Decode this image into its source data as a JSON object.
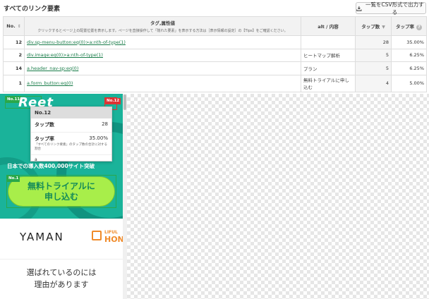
{
  "header": {
    "title": "すべてのリンク要素",
    "csv_button": "一覧をCSV形式で出力する"
  },
  "table": {
    "col_no": "No.",
    "col_tag": "タグ,属性値",
    "col_tag_note": "クリックするとページ上の配置位置を表示します。ページを直接操作して「隠れた要素」を表示する方法は［表示情報の設定］の【Tips】をご確認ください。",
    "col_alt": "alt / 内容",
    "col_count": "タップ数",
    "col_rate": "タップ率",
    "rows": [
      {
        "no": "12",
        "tag": "div.sp-menu-button:eq(0)>a:nth-of-type(1)",
        "alt": "",
        "count": "28",
        "rate": "35.00%"
      },
      {
        "no": "2",
        "tag": "div.image:eq(0)>a:nth-of-type(1)",
        "alt": "ヒートマップ解析",
        "count": "5",
        "rate": "6.25%"
      },
      {
        "no": "14",
        "tag": "a.header_nav-sp:eq(0)",
        "alt": "プラン",
        "count": "5",
        "rate": "6.25%"
      },
      {
        "no": "1",
        "tag": "a.form_button:eq(0)",
        "alt": "無料トライアルに申し込む",
        "count": "4",
        "rate": "5.00%"
      }
    ]
  },
  "preview": {
    "logo": "Reet",
    "badge_11": "No.11",
    "badge_12": "No.12",
    "badge_1": "No.1",
    "hero_sub": "日本での導入数400,000サイト突破",
    "cta_line1": "無料トライアルに",
    "cta_line2": "申し込む",
    "logo_yaman": "YAMAN",
    "logo_lifull_small": "LIFUL",
    "logo_lifull_big": "HON",
    "reason_line1": "選ばれているのには",
    "reason_line2": "理由があります"
  },
  "tooltip": {
    "title": "No.12",
    "count_label": "タップ数",
    "count_value": "28",
    "rate_label": "タップ率",
    "rate_value": "35.00%",
    "rate_note": "「すべてのリンク要素」のタップ数の合計に対する割合",
    "selector": "a"
  },
  "colors": {
    "hero_bg": "#1ab39a",
    "cta_bg": "#a8ee4a",
    "link": "#1a7d4a"
  }
}
